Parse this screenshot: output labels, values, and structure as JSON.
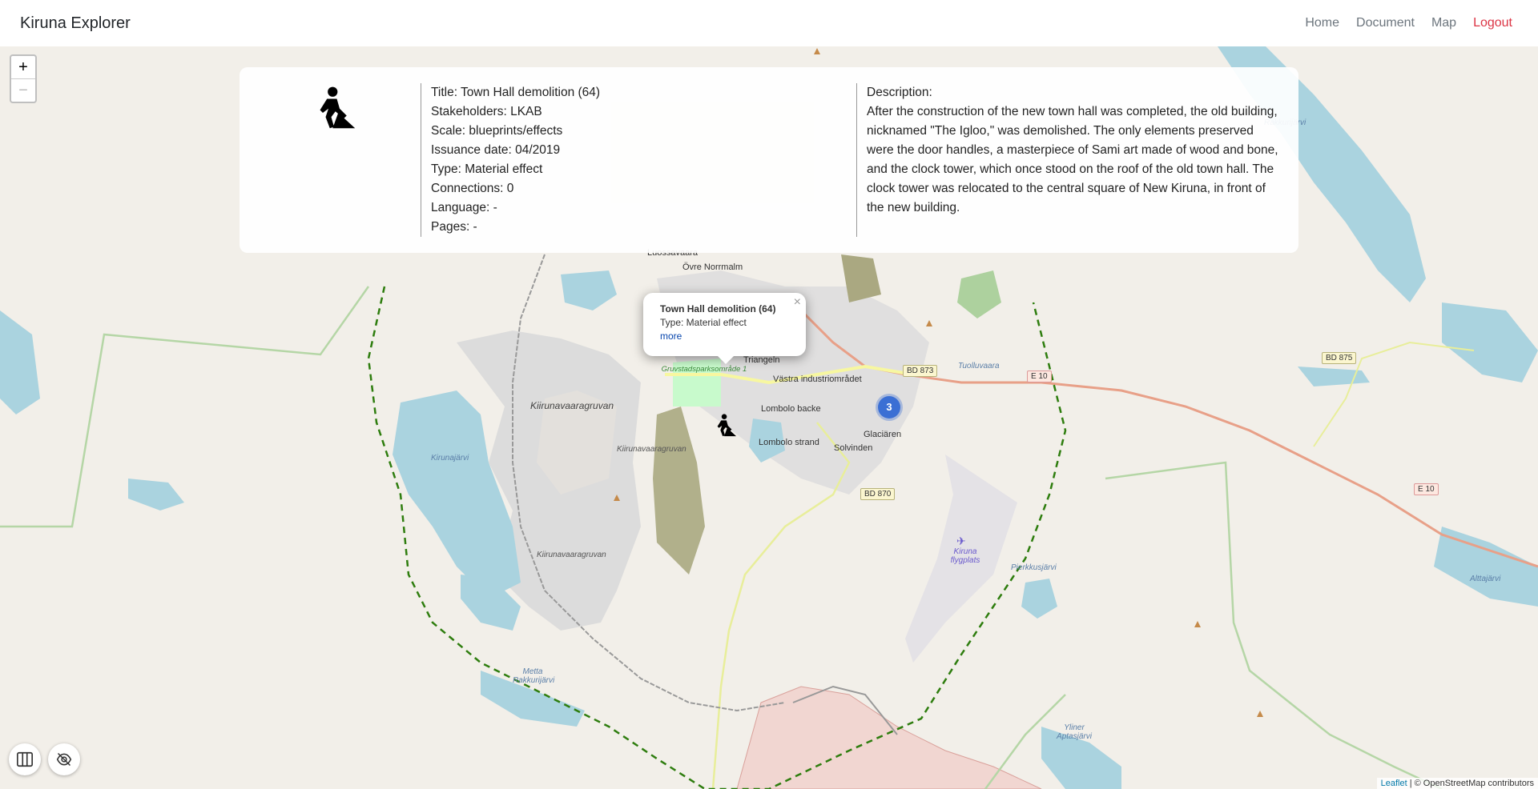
{
  "navbar": {
    "brand": "Kiruna Explorer",
    "links": {
      "home": "Home",
      "document": "Document",
      "map": "Map",
      "logout": "Logout"
    }
  },
  "map": {
    "zoom_in": "+",
    "zoom_out": "−",
    "place_labels": {
      "luossavaara": "Luossavaara",
      "ovre_norrmalm": "Övre Norrmalm",
      "triangeln": "Triangeln",
      "vastra": "Västra industriområdet",
      "lombolo_backe": "Lombolo backe",
      "lombolo_strand": "Lombolo strand",
      "glaciaren": "Glaciären",
      "solvinden": "Solvinden",
      "kiirunavaaragruvan_main": "Kiirunavaaragruvan",
      "kiirunavaaragruvan_2": "Kiirunavaaragruvan",
      "kiirunavaaragruvan_3": "Kiirunavaaragruvan",
      "gruvstadsparken": "Gruvstadsparksområde 1",
      "kiruna_flygplats": "Kiruna flygplats",
      "kirunajarvi": "Kirunajärvi",
      "tuolluvaara": "Tuolluvaara",
      "rakkurijarvi": "Rakkurijärvi",
      "pierkkusjarvi": "Pierkkusjärvi",
      "alttajarvi": "Alttajärvi",
      "yliner_aptasjarvi": "Yliner Aptasjärvi",
      "metta_rakkurijarvi": "Metta Rakkurijärvi"
    },
    "road_shields": {
      "bd873": "BD 873",
      "e10_a": "E 10",
      "bd875": "BD 875",
      "e10_b": "E 10",
      "bd870": "BD 870"
    },
    "cluster_count": "3",
    "attribution": {
      "leaflet": "Leaflet",
      "osm": "| © OpenStreetMap contributors"
    }
  },
  "info_card": {
    "icon": "construction-worker-icon",
    "fields": {
      "title": "Title: Town Hall demolition (64)",
      "stakeholders": "Stakeholders: LKAB",
      "scale": "Scale: blueprints/effects",
      "issuance_date": "Issuance date: 04/2019",
      "type": "Type: Material effect",
      "connections": "Connections: 0",
      "language": "Language: -",
      "pages": "Pages: -"
    },
    "description_label": "Description:",
    "description": "After the construction of the new town hall was completed, the old building, nicknamed \"The Igloo,\" was demolished. The only elements preserved were the door handles, a masterpiece of Sami art made of wood and bone, and the clock tower, which once stood on the roof of the old town hall. The clock tower was relocated to the central square of New Kiruna, in front of the new building."
  },
  "popup": {
    "title": "Town Hall demolition (64)",
    "type": "Type: Material effect",
    "more": "more",
    "close": "×"
  },
  "colors": {
    "water": "#aad3df",
    "land": "#f2efe9",
    "boundary": "#2e7d0e",
    "logout": "#dc3545"
  }
}
